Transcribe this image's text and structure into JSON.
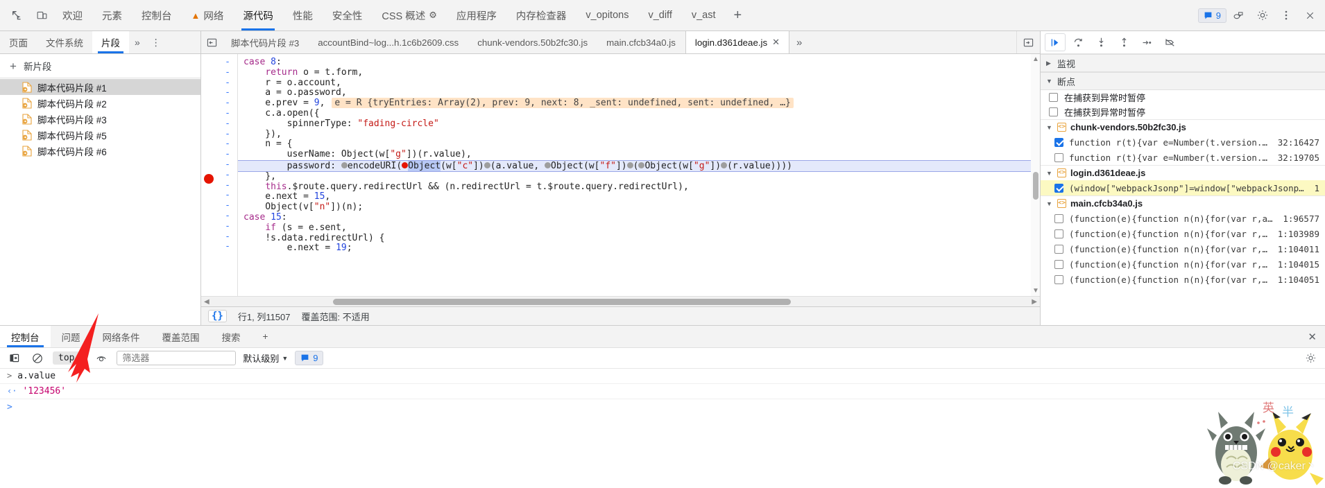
{
  "topbar": {
    "icons": [
      "inspect-icon",
      "device-toolbar-icon"
    ],
    "tabs": [
      {
        "label": "欢迎",
        "active": false,
        "icon": null
      },
      {
        "label": "元素",
        "active": false,
        "icon": null
      },
      {
        "label": "控制台",
        "active": false,
        "icon": null
      },
      {
        "label": "网络",
        "active": false,
        "icon": "warning-triangle-icon"
      },
      {
        "label": "源代码",
        "active": true,
        "icon": null
      },
      {
        "label": "性能",
        "active": false,
        "icon": null
      },
      {
        "label": "安全性",
        "active": false,
        "icon": null
      },
      {
        "label": "CSS 概述",
        "active": false,
        "icon": "beaker-icon"
      },
      {
        "label": "应用程序",
        "active": false,
        "icon": null
      },
      {
        "label": "内存检查器",
        "active": false,
        "icon": null
      },
      {
        "label": "v_opitons",
        "active": false,
        "icon": null
      },
      {
        "label": "v_diff",
        "active": false,
        "icon": null
      },
      {
        "label": "v_ast",
        "active": false,
        "icon": null
      }
    ],
    "add_tab_label": "+",
    "message_count": "9",
    "right_icons": [
      "devices-message-icon",
      "settings-gear-icon",
      "more-vertical-icon",
      "close-icon"
    ],
    "accent": "#1a73e8"
  },
  "navigator": {
    "tabs": [
      {
        "label": "页面",
        "active": false
      },
      {
        "label": "文件系统",
        "active": false
      },
      {
        "label": "片段",
        "active": true
      }
    ],
    "more_label": "»",
    "menu_label": "⋮",
    "new_snippet_label": "新片段",
    "snippets": [
      {
        "label": "脚本代码片段 #1",
        "selected": true
      },
      {
        "label": "脚本代码片段 #2",
        "selected": false
      },
      {
        "label": "脚本代码片段 #3",
        "selected": false
      },
      {
        "label": "脚本代码片段 #5",
        "selected": false
      },
      {
        "label": "脚本代码片段 #6",
        "selected": false
      }
    ]
  },
  "file_tabs": {
    "items": [
      {
        "label": "脚本代码片段 #3",
        "active": false,
        "closable": false
      },
      {
        "label": "accountBind~log...h.1c6b2609.css",
        "active": false,
        "closable": false
      },
      {
        "label": "chunk-vendors.50b2fc30.js",
        "active": false,
        "closable": false
      },
      {
        "label": "main.cfcb34a0.js",
        "active": false,
        "closable": false
      },
      {
        "label": "login.d361deae.js",
        "active": true,
        "closable": true
      }
    ],
    "overflow_label": "»"
  },
  "editor": {
    "tooltip": "e = R {tryEntries: Array(2), prev: 9, next: 8, _sent: undefined, sent: undefined, …}",
    "gutter_marks": [
      "-",
      "-",
      "-",
      "-",
      "-",
      "-",
      "-",
      "-",
      "-",
      "-",
      "-",
      "-",
      "-",
      "-",
      "-",
      "-",
      "-",
      "-",
      "-"
    ],
    "breakpoint_line_index": 10,
    "highlighted_line_index": 10,
    "lines": [
      "case 8:",
      "    return o = t.form,",
      "    r = o.account,",
      "    a = o.password,",
      "    e.prev = 9,",
      "    c.a.open({",
      "        spinnerType: \"fading-circle\"",
      "    }),",
      "    n = {",
      "        userName: Object(w[\"g\"])(r.value),",
      "        password: encodeURI(Object(w[\"c\"])(a.value, Object(w[\"f\"])(Object(w[\"g\"])(r.value))))",
      "    },",
      "    this.$route.query.redirectUrl && (n.redirectUrl = t.$route.query.redirectUrl),",
      "    e.next = 15,",
      "    Object(v[\"n\"])(n);",
      "case 15:",
      "    if (s = e.sent,",
      "    !s.data.redirectUrl) {",
      "        e.next = 19;"
    ],
    "status": {
      "format_icon": "{}",
      "position": "行1, 列11507",
      "coverage": "覆盖范围: 不适用"
    }
  },
  "debugger": {
    "toolbar_buttons": [
      "resume-script-execution-icon",
      "step-over-next-function-call-icon",
      "step-into-next-function-call-icon",
      "step-out-of-current-function-icon",
      "step-icon",
      "deactivate-breakpoints-icon"
    ],
    "watch": {
      "title": "监视",
      "expanded": false
    },
    "breakpoints": {
      "title": "断点",
      "expanded": true,
      "pause_options": [
        {
          "label": "在捕获到异常时暂停",
          "checked": false
        },
        {
          "label": "在捕获到异常时暂停",
          "checked": false
        }
      ],
      "groups": [
        {
          "file": "chunk-vendors.50b2fc30.js",
          "expanded": true,
          "items": [
            {
              "code": "function r(t){var e=Number(t.version.split…",
              "loc": "32:16427",
              "checked": true,
              "highlight": false
            },
            {
              "code": "function r(t){var e=Number(t.version.split…",
              "loc": "32:19705",
              "checked": false,
              "highlight": false
            }
          ]
        },
        {
          "file": "login.d361deae.js",
          "expanded": true,
          "items": [
            {
              "code": "(window[\"webpackJsonp\"]=window[\"webpackJsonp\"]|…",
              "loc": "1",
              "checked": true,
              "highlight": true
            }
          ]
        },
        {
          "file": "main.cfcb34a0.js",
          "expanded": true,
          "items": [
            {
              "code": "(function(e){function n(n){for(var r,a,i=n[…",
              "loc": "1:96577",
              "checked": false,
              "highlight": false
            },
            {
              "code": "(function(e){function n(n){for(var r,a,i=n…",
              "loc": "1:103989",
              "checked": false,
              "highlight": false
            },
            {
              "code": "(function(e){function n(n){for(var r,a,i=n…",
              "loc": "1:104011",
              "checked": false,
              "highlight": false
            },
            {
              "code": "(function(e){function n(n){for(var r,a,i=n…",
              "loc": "1:104015",
              "checked": false,
              "highlight": false
            },
            {
              "code": "(function(e){function n(n){for(var r,a,i=n…",
              "loc": "1:104051",
              "checked": false,
              "highlight": false
            }
          ]
        }
      ]
    }
  },
  "drawer": {
    "tabs": [
      {
        "label": "控制台",
        "active": true
      },
      {
        "label": "问题",
        "active": false
      },
      {
        "label": "网络条件",
        "active": false
      },
      {
        "label": "覆盖范围",
        "active": false
      },
      {
        "label": "搜索",
        "active": false
      }
    ],
    "add_label": "+",
    "close_label": "✕",
    "toolbar": {
      "sidebar_icon": "console-sidebar-icon",
      "clear_icon": "clear-console-icon",
      "context": "top",
      "eye_icon": "live-expression-icon",
      "filter_value": "",
      "filter_placeholder": "筛选器",
      "level": "默认级别",
      "message_icon": "message-icon",
      "message_count": "9"
    },
    "entries": [
      {
        "type": "input",
        "marker": ">",
        "text": "a.value"
      },
      {
        "type": "output",
        "marker": "‹·",
        "text": "'123456'"
      }
    ],
    "prompt_marker": ">"
  },
  "watermark": "CSDN @caker丶"
}
